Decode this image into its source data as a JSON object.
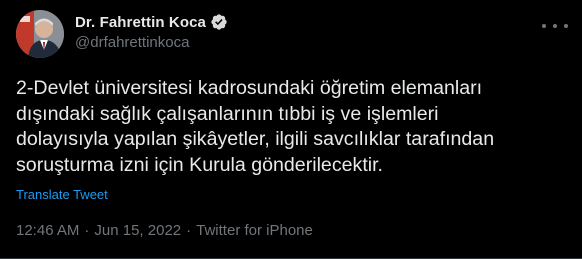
{
  "author": {
    "display_name": "Dr. Fahrettin Koca",
    "handle": "@drfahrettinkoca",
    "verified": true,
    "avatar_icon": "profile-photo"
  },
  "tweet": {
    "text": "2-Devlet üniversitesi kadrosundaki öğretim elemanları\ndışındaki sağlık çalışanlarının tıbbi iş ve işlemleri\ndolayısıyla yapılan şikâyetler, ilgili savcılıklar tarafından\nsoruşturma izni için Kurula gönderilecektir.",
    "translate_label": "Translate Tweet",
    "time": "12:46 AM",
    "date": "Jun 15, 2022",
    "source": "Twitter for iPhone",
    "separator": "·"
  },
  "colors": {
    "background": "#000000",
    "text": "#e7e9ea",
    "muted": "#71767b",
    "link": "#1d9bf0",
    "verified_badge": "#1d9bf0"
  }
}
